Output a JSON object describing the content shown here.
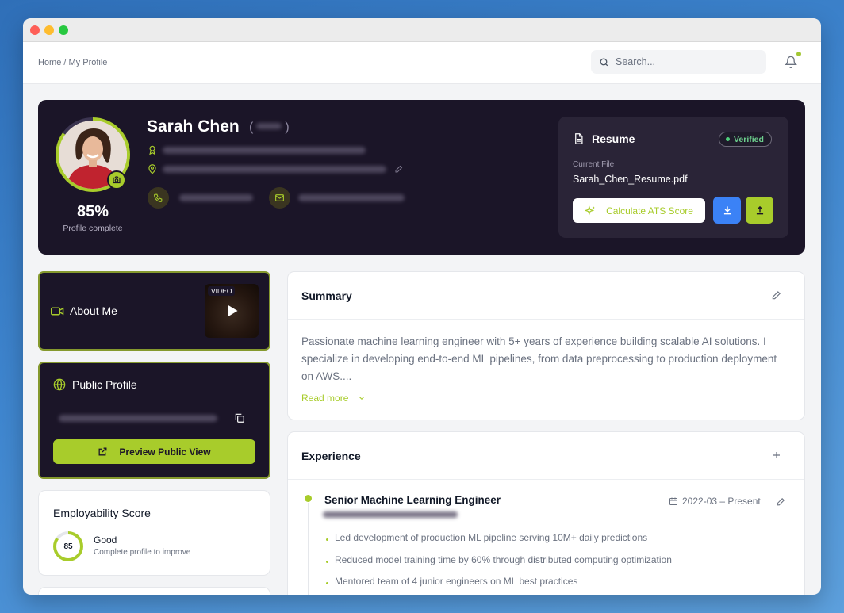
{
  "topbar": {
    "breadcrumb": "Home / My Profile",
    "search_placeholder": "Search..."
  },
  "profile": {
    "name": "Sarah Chen",
    "pronouns_redacted": "( )",
    "completion": "85%",
    "completion_label": "Profile complete"
  },
  "resume": {
    "title": "Resume",
    "status": "Verified",
    "current_file_label": "Current File",
    "file_name": "Sarah_Chen_Resume.pdf",
    "ats_button": "Calculate ATS Score"
  },
  "about": {
    "title": "About Me",
    "video_badge": "VIDEO"
  },
  "public_profile": {
    "title": "Public Profile",
    "preview_button": "Preview Public View"
  },
  "employability": {
    "title": "Employability Score",
    "score": "85",
    "rating": "Good",
    "hint": "Complete profile to improve"
  },
  "summary": {
    "title": "Summary",
    "text": "Passionate machine learning engineer with 5+ years of experience building scalable AI solutions. I specialize in developing end-to-end ML pipelines, from data preprocessing to production deployment on AWS....",
    "read_more": "Read more"
  },
  "experience": {
    "title": "Experience",
    "jobs": [
      {
        "title": "Senior Machine Learning Engineer",
        "date": "2022-03 – Present",
        "bullets": [
          "Led development of production ML pipeline serving 10M+ daily predictions",
          "Reduced model training time by 60% through distributed computing optimization",
          "Mentored team of 4 junior engineers on ML best practices"
        ]
      }
    ]
  },
  "colors": {
    "accent": "#a8cc2b",
    "dark_card": "#1b1528",
    "blue_button": "#3b82f6"
  }
}
